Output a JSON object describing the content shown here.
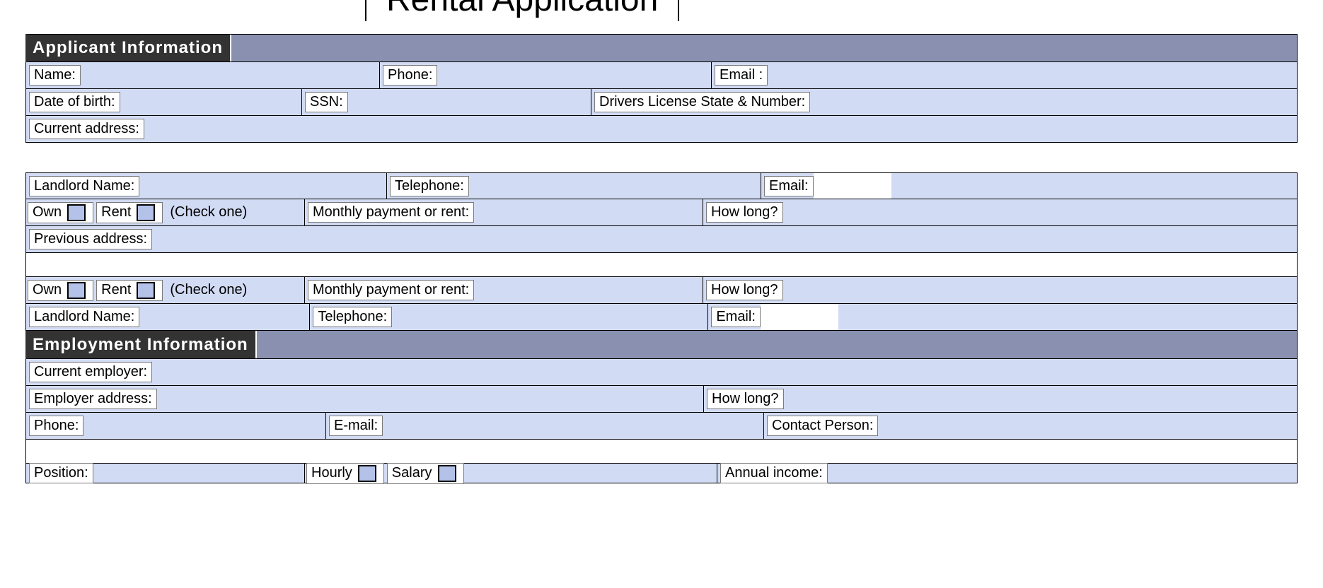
{
  "title": "Rental Application",
  "sections": {
    "applicant": "Applicant Information",
    "employment": "Employment Information"
  },
  "labels": {
    "name": "Name:",
    "phone": "Phone:",
    "email": "Email :",
    "dob": "Date of birth:",
    "ssn": "SSN:",
    "dl": "Drivers License State & Number:",
    "current_address": "Current address:",
    "landlord_name": "Landlord Name:",
    "telephone": "Telephone:",
    "email2": "Email:",
    "own": "Own",
    "rent": "Rent",
    "checkone": "(Check one)",
    "monthly": "Monthly payment or rent:",
    "howlong": "How long?",
    "previous_address": "Previous address:",
    "current_employer": "Current employer:",
    "employer_address": "Employer address:",
    "phone2": "Phone:",
    "email3": "E-mail:",
    "contact_person": "Contact Person:",
    "position": "Position:",
    "hourly": "Hourly",
    "salary": "Salary",
    "annual_income": "Annual income:"
  }
}
